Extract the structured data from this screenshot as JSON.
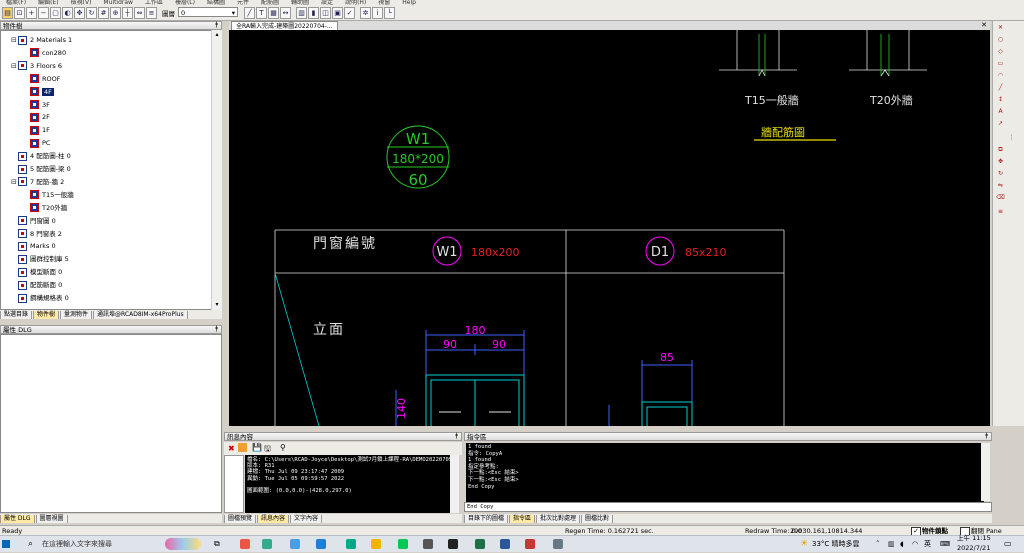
{
  "menubar": {
    "items": [
      "檔案(F)",
      "編輯(E)",
      "檢視(V)",
      "Multidraw",
      "工作區",
      "樓層(L)",
      "結構圖",
      "元件",
      "配筋圖",
      "輔助圖",
      "設定",
      "說明(H)",
      "視窗",
      "Help"
    ]
  },
  "toolbar": {
    "floor_label": "圖層",
    "floor_value": "0"
  },
  "tree": {
    "title": "物件樹",
    "nodes": [
      {
        "label": "2 Materials 1",
        "expander": "⊟"
      },
      {
        "label": "con280",
        "expander": ""
      },
      {
        "label": "3 Floors 6",
        "expander": "⊟"
      },
      {
        "label": "ROOF",
        "expander": ""
      },
      {
        "label": "4F",
        "expander": ""
      },
      {
        "label": "3F",
        "expander": ""
      },
      {
        "label": "2F",
        "expander": ""
      },
      {
        "label": "1F",
        "expander": ""
      },
      {
        "label": "PC",
        "expander": ""
      },
      {
        "label": "4 配筋圖-柱 0",
        "expander": ""
      },
      {
        "label": "5 配筋圖-梁 0",
        "expander": ""
      },
      {
        "label": "7 配筋-牆 2",
        "expander": "⊟"
      },
      {
        "label": "T15一般牆",
        "expander": ""
      },
      {
        "label": "T20外牆",
        "expander": ""
      },
      {
        "label": "門窗圖 0",
        "expander": ""
      },
      {
        "label": "8 門窗表 2",
        "expander": ""
      },
      {
        "label": "Marks 0",
        "expander": ""
      },
      {
        "label": "圖群控制庫 5",
        "expander": ""
      },
      {
        "label": "模型斷面 0",
        "expander": ""
      },
      {
        "label": "配筋斷面 0",
        "expander": ""
      },
      {
        "label": "鋼構規格表 0",
        "expander": ""
      }
    ],
    "tabs": [
      "點選目錄",
      "物件樹",
      "量測物件",
      "通訊埠@RCAD8IM-x64ProPlus"
    ]
  },
  "props": {
    "title": "屬性 DLG",
    "tabs": [
      "屬性 DLG",
      "圖層視圖"
    ]
  },
  "document": {
    "tab_label": "全RA輸入完成-建築圖20220704-..."
  },
  "drawing": {
    "wall_labels": [
      "T15一般牆",
      "T20外牆"
    ],
    "wall_title": "牆配筋圖",
    "window_tag": {
      "code": "W1",
      "size": "180*200",
      "height": "60"
    },
    "table_header": "門窗編號",
    "table_row": "立面",
    "w1": {
      "code": "W1",
      "size": "180x200"
    },
    "d1": {
      "code": "D1",
      "size": "85x210"
    },
    "dims": {
      "w_total": "180",
      "w_left": "90",
      "w_right": "90",
      "d_total": "85",
      "w_height": "140"
    }
  },
  "message_panel": {
    "title": "訊息內容",
    "lines": [
      "檔名: C:\\Users\\RCAD-Joyce\\Desktop\\測試7月鎖上課程-RA\\DEMO20220705\\2",
      "版本: R31",
      "建檔: Thu Jul 09 23:17:47 2009",
      "異動: Tue Jul 05 09:59:57 2022",
      "",
      "圖面範圍: (0.0,0.0)-(428.0,297.0)"
    ],
    "tabs": [
      "圖檔預覽",
      "訊息內容",
      "文字內容"
    ]
  },
  "command_panel": {
    "title": "指令區",
    "lines": [
      "1 found",
      "指令: CopyA",
      "1 found",
      "指定參考點:",
      "下一點:<Esc 結束>",
      "下一點:<Esc 結束>",
      "End Copy"
    ],
    "input": "End Copy",
    "tabs": [
      "目錄下的圖檔",
      "指令區",
      "批次比對處理",
      "圖檔比對"
    ]
  },
  "statusbar": {
    "ready": "Ready",
    "regen": "Regen Time: 0.162721 sec.",
    "redraw": "Redraw Time: 0.0",
    "coords": "29030.161,10814.344",
    "snap": "物件鎖點",
    "ortho": "翻閉 Pane"
  },
  "taskbar": {
    "search_placeholder": "在這裡輸入文字來搜尋",
    "weather": "33°C 晴時多雲",
    "ime": "英",
    "time": "上午 11:15",
    "date": "2022/7/21"
  },
  "colors": {
    "canvas": "#000000",
    "dim": "#ff00ff",
    "text_green": "#28c828",
    "text_white": "#e0e0e0",
    "text_red": "#e02020",
    "text_yellow": "#e8e000",
    "line_cyan": "#00d0d0"
  }
}
